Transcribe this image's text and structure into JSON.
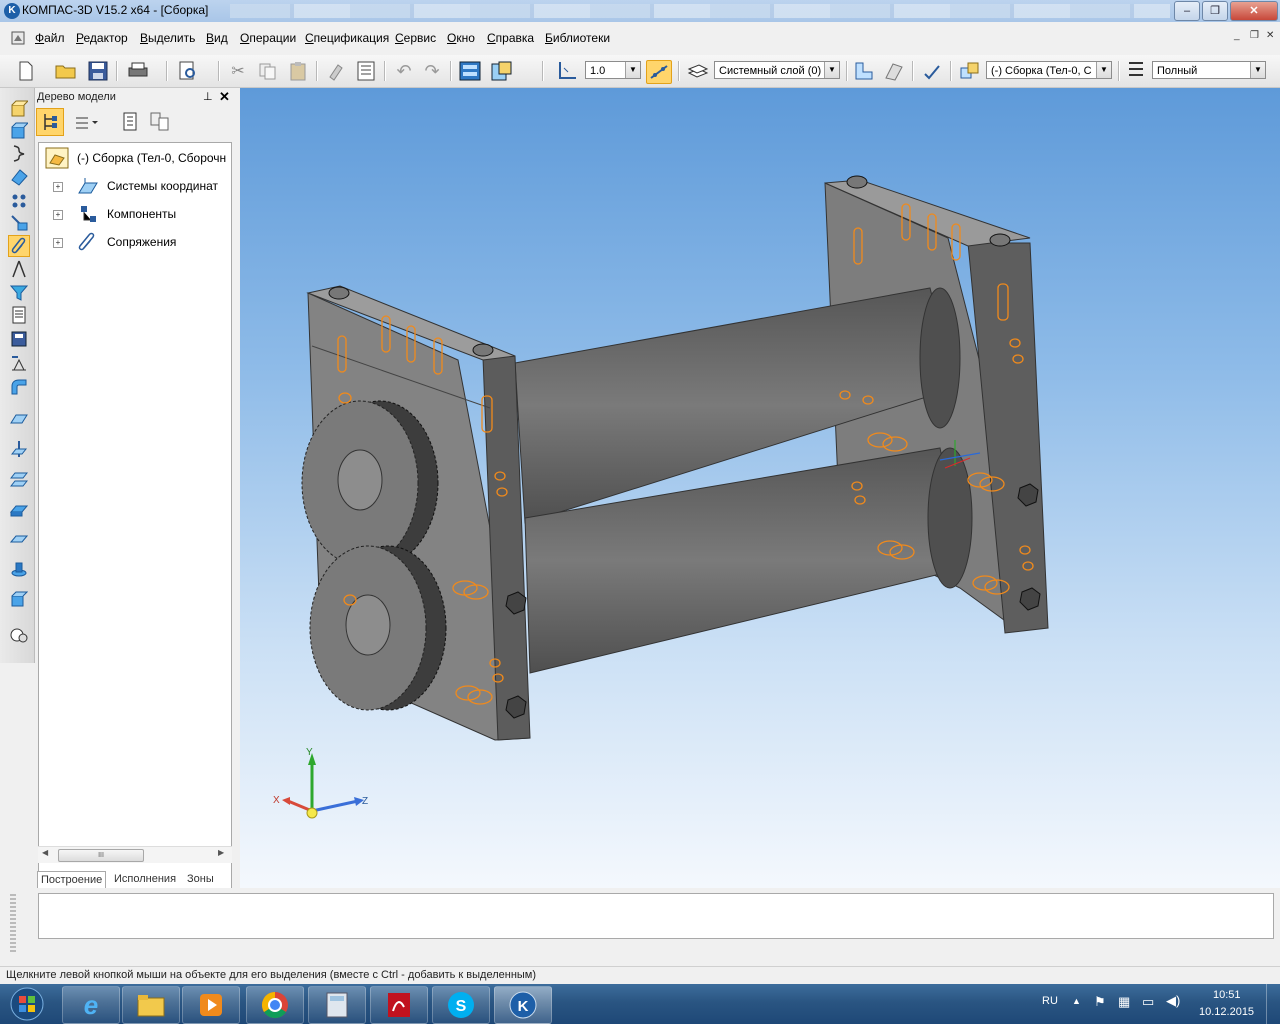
{
  "window": {
    "title": "КОМПАС-3D V15.2  x64 - [Сборка]"
  },
  "menu": [
    "Файл",
    "Редактор",
    "Выделить",
    "Вид",
    "Операции",
    "Спецификация",
    "Сервис",
    "Окно",
    "Справка",
    "Библиотеки"
  ],
  "toolbar": {
    "step_value": "1.0",
    "layer": "Системный слой (0)",
    "assembly": "(-) Сборка (Тел-0, С",
    "display_mode": "Полный"
  },
  "tree_panel": {
    "title": "Дерево модели",
    "root": "(-) Сборка (Тел-0, Сборочн",
    "items": [
      "Системы координат",
      "Компоненты",
      "Сопряжения"
    ],
    "scroll_label": "III",
    "tabs": [
      "Построение",
      "Исполнения",
      "Зоны"
    ]
  },
  "axes": {
    "x": "X",
    "y": "Y",
    "z": "Z"
  },
  "status": {
    "hint": "Щелкните левой кнопкой мыши на объекте для его выделения (вместе с Ctrl - добавить к выделенным)"
  },
  "taskbar": {
    "lang": "RU",
    "time": "10:51",
    "date": "10.12.2015"
  },
  "colors": {
    "accent": "#ffd56b",
    "viewport_top": "#5e9ad9",
    "model": "#6e6e6e",
    "hidden_edges": "#f08a1c"
  }
}
